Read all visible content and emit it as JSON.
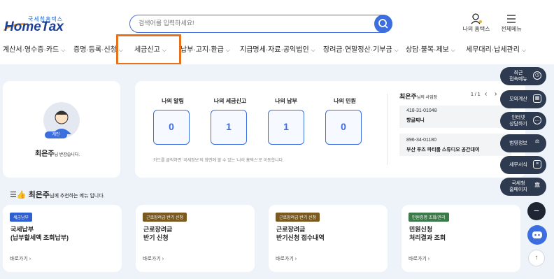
{
  "header": {
    "logo_small": "국세청홈택스",
    "logo_main": "HomeTax",
    "search_placeholder": "검색어를 입력하세요!",
    "my_hometax": "나의 홈택스",
    "all_menu": "전체메뉴"
  },
  "nav": [
    {
      "label": "계산서·영수증·카드"
    },
    {
      "label": "증명·등록·신청"
    },
    {
      "label": "세금신고"
    },
    {
      "label": "납부·고지·환급"
    },
    {
      "label": "지급명세·자료·공익법인"
    },
    {
      "label": "장려금·연말정산·기부금"
    },
    {
      "label": "상담·불복·제보"
    },
    {
      "label": "세무대리·납세관리"
    }
  ],
  "profile": {
    "badge": "개인",
    "name": "최은주",
    "greeting": "님 반갑습니다."
  },
  "my_stats": {
    "items": [
      {
        "label": "나의 알림",
        "value": "0"
      },
      {
        "label": "나의 세금신고",
        "value": "1"
      },
      {
        "label": "나의 납부",
        "value": "1"
      },
      {
        "label": "나의 민원",
        "value": "0"
      }
    ],
    "note": "카드를 클릭하면 '국세정보'의 화면에 볼 수 있는 '나의 홈택스'로 이동합니다."
  },
  "business": {
    "name": "최은주",
    "suffix": "님의 사업장",
    "pager": "1 / 1",
    "items": [
      {
        "reg_no": "418-31-01048",
        "name": "향글찌니"
      },
      {
        "reg_no": "896-34-01180",
        "name": "부산 푸즈 파티룸 스튜디오 공간대여"
      }
    ]
  },
  "recommend": {
    "name": "최은주",
    "suffix": "님께 추천하는 메뉴 입니다."
  },
  "rec_cards": [
    {
      "tag": "세금납부",
      "tag_color": "#2f5fd0",
      "title1": "국세납부",
      "title2": "(납부할세액 조회납부)",
      "go": "바로가기"
    },
    {
      "tag": "근로장려금 반기 신청",
      "tag_color": "#7a5a1e",
      "title1": "근로장려금",
      "title2": "반기 신청",
      "go": "바로가기"
    },
    {
      "tag": "근로장려금 반기 신청",
      "tag_color": "#7a5a1e",
      "title1": "근로장려금",
      "title2": "반기신청 접수내역",
      "go": "바로가기"
    },
    {
      "tag": "민원증명 조회/관리",
      "tag_color": "#3d7a4a",
      "title1": "민원신청",
      "title2": "처리결과 조회",
      "go": "바로가기"
    }
  ],
  "side_menu": [
    {
      "label": "최근\n접속메뉴"
    },
    {
      "label": "모의계산"
    },
    {
      "label": "인터넷\n상담하기"
    },
    {
      "label": "범영정보"
    },
    {
      "label": "세무서식"
    },
    {
      "label": "국세청\n홈페이지"
    }
  ],
  "colors": {
    "accent": "#3d6ee0",
    "highlight": "#e8711c",
    "side_bg": "#2e3a4f",
    "body_bg": "#eef3fa"
  }
}
